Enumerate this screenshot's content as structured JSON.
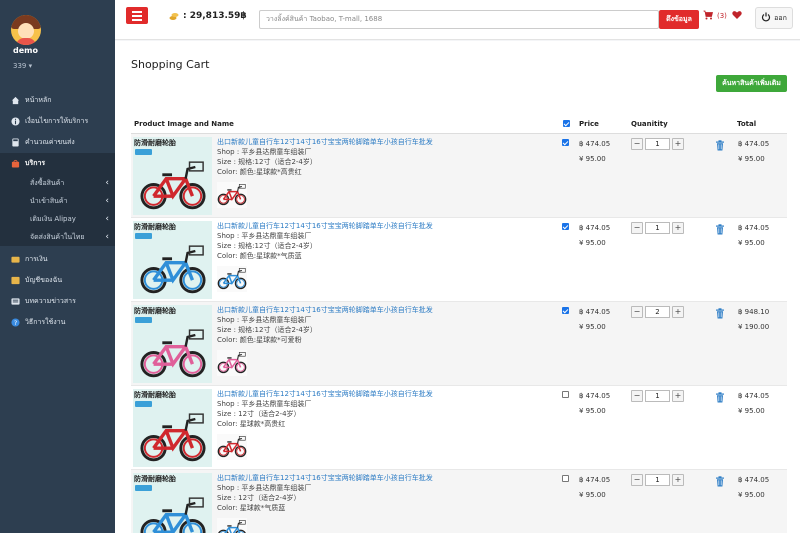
{
  "colors": {
    "accent": "#e12b2b",
    "sidebar": "#2d3e50",
    "green": "#3ea83a",
    "link": "#2b7bc4"
  },
  "sidebar": {
    "user_name": "demo",
    "user_code": "339 ▾",
    "items": [
      {
        "label": "หน้าหลัก",
        "icon": "home-icon"
      },
      {
        "label": "เงื่อนไขการให้บริการ",
        "icon": "info-icon"
      },
      {
        "label": "คำนวณค่าขนส่ง",
        "icon": "calculator-icon"
      },
      {
        "label": "บริการ",
        "icon": "bag-icon"
      }
    ],
    "sub_items": [
      {
        "label": "สั่งซื้อสินค้า"
      },
      {
        "label": "นำเข้าสินค้า"
      },
      {
        "label": "เติมเงิน Alipay"
      },
      {
        "label": "จัดส่งสินค้าในไทย"
      }
    ],
    "items2": [
      {
        "label": "การเงิน",
        "icon": "wallet-icon"
      },
      {
        "label": "บัญชีของฉัน",
        "icon": "account-icon"
      },
      {
        "label": "บทความข่าวสาร",
        "icon": "news-icon"
      },
      {
        "label": "วิธีการใช้งาน",
        "icon": "help-icon"
      }
    ]
  },
  "topbar": {
    "balance": ": 29,813.59฿",
    "search_placeholder": "วางลิ้งค์สินค้า Taobao, T-mall, 1688",
    "search_button": "ดึงข้อมูล",
    "cart_count": "(3)",
    "logout": "ออก"
  },
  "page": {
    "title": "Shopping Cart",
    "more_button": "ค้นหาสินค้าเพิ่มเติม",
    "headers": {
      "product": "Product Image and Name",
      "price": "Price",
      "quantity": "Quanitity",
      "total": "Total"
    }
  },
  "cart": [
    {
      "title": "出口新款儿童自行车12寸14寸16寸宝宝两轮脚踏单车小孩自行车批发",
      "shop": "Shop : 平乡县达鼎童车组装厂",
      "spec": "Size : 规格:12寸（适合2-4岁）",
      "color": "Color: 颜色:星球款*高贵红",
      "checked": true,
      "price_thb": "฿ 474.05",
      "price_cny": "¥ 95.00",
      "qty": "1",
      "total_thb": "฿ 474.05",
      "total_cny": "¥ 95.00",
      "bike_color": "#d0282e"
    },
    {
      "title": "出口新款儿童自行车12寸14寸16寸宝宝两轮脚踏单车小孩自行车批发",
      "shop": "Shop : 平乡县达鼎童车组装厂",
      "spec": "Size : 规格:12寸（适合2-4岁）",
      "color": "Color: 颜色:星球款*气质蓝",
      "checked": true,
      "price_thb": "฿ 474.05",
      "price_cny": "¥ 95.00",
      "qty": "1",
      "total_thb": "฿ 474.05",
      "total_cny": "¥ 95.00",
      "bike_color": "#2f8fd8"
    },
    {
      "title": "出口新款儿童自行车12寸14寸16寸宝宝两轮脚踏单车小孩自行车批发",
      "shop": "Shop : 平乡县达鼎童车组装厂",
      "spec": "Size : 规格:12寸（适合2-4岁）",
      "color": "Color: 颜色:星球款*可爱粉",
      "checked": true,
      "price_thb": "฿ 474.05",
      "price_cny": "¥ 95.00",
      "qty": "2",
      "total_thb": "฿ 948.10",
      "total_cny": "¥ 190.00",
      "bike_color": "#e0609a"
    },
    {
      "title": "出口新款儿童自行车12寸14寸16寸宝宝两轮脚踏单车小孩自行车批发",
      "shop": "Shop : 平乡县达鼎童车组装厂",
      "spec": "Size : 12寸（适合2-4岁）",
      "color": "Color: 星球款*高贵红",
      "checked": false,
      "price_thb": "฿ 474.05",
      "price_cny": "¥ 95.00",
      "qty": "1",
      "total_thb": "฿ 474.05",
      "total_cny": "¥ 95.00",
      "bike_color": "#d0282e"
    },
    {
      "title": "出口新款儿童自行车12寸14寸16寸宝宝两轮脚踏单车小孩自行车批发",
      "shop": "Shop : 平乡县达鼎童车组装厂",
      "spec": "Size : 12寸（适合2-4岁）",
      "color": "Color: 星球款*气质蓝",
      "checked": false,
      "price_thb": "฿ 474.05",
      "price_cny": "¥ 95.00",
      "qty": "1",
      "total_thb": "฿ 474.05",
      "total_cny": "¥ 95.00",
      "bike_color": "#2f8fd8"
    }
  ],
  "image_brand": "防滑耐磨轮胎"
}
